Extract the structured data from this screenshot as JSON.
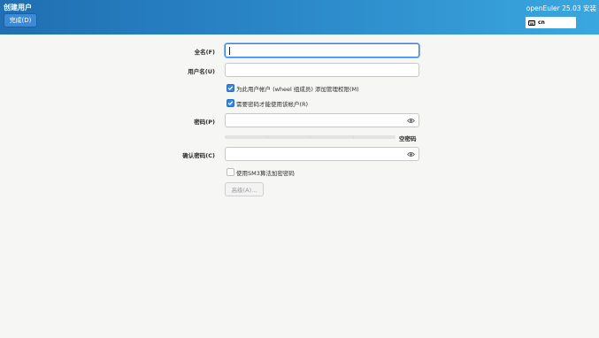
{
  "header": {
    "title": "创建用户",
    "done_label": "完成(D)",
    "product": "openEuler 25.03 安装",
    "keyboard_layout": "cn"
  },
  "form": {
    "fullname_label": "全名(F)",
    "fullname_value": "",
    "username_label": "用户名(U)",
    "username_value": "",
    "admin_checkbox": {
      "label": "为此用户帐户 (wheel 组成员) 添加管理权限(M)",
      "checked": true
    },
    "require_password_checkbox": {
      "label": "需要密码才能使用该帐户(R)",
      "checked": true
    },
    "password_label": "密码(P)",
    "password_value": "",
    "strength_label": "空密码",
    "confirm_label": "确认密码(C)",
    "confirm_value": "",
    "sm3_checkbox": {
      "label": "使用SM3算法加密密码",
      "checked": false
    },
    "advanced_label": "高级(A)..."
  },
  "icons": {
    "keyboard": "keyboard-icon",
    "eye": "eye-icon",
    "check": "checkmark-icon"
  },
  "colors": {
    "header_start": "#1f6fb2",
    "header_end": "#3aa7df",
    "accent": "#3584e4"
  }
}
